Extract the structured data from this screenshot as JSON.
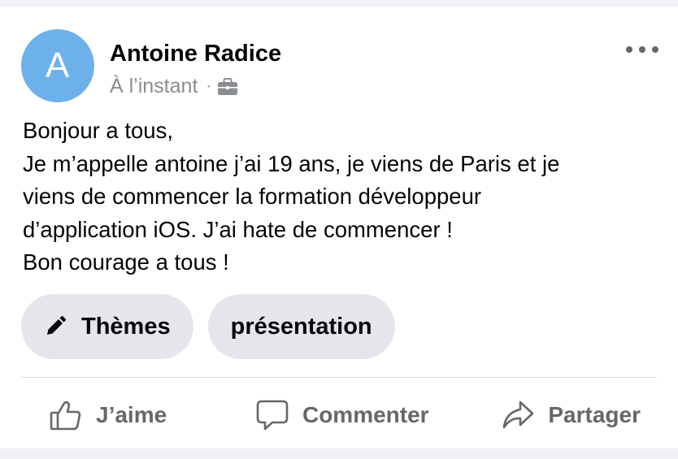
{
  "post": {
    "author": {
      "initial": "A",
      "name": "Antoine Radice",
      "avatar_color": "#6db1ea"
    },
    "meta": {
      "time": "À l’instant",
      "separator": "·",
      "visibility_icon": "briefcase-icon"
    },
    "more_icon": "more-options-icon",
    "body_lines": [
      "Bonjour a tous,",
      "Je m’appelle antoine j’ai 19 ans, je viens de Paris et je",
      "viens de commencer la formation développeur",
      "d’application iOS. J’ai hate de commencer !",
      "Bon courage a tous !"
    ],
    "tags": [
      {
        "label": "Thèmes",
        "icon": "pencil-icon"
      },
      {
        "label": "présentation"
      }
    ],
    "actions": [
      {
        "label": "J’aime",
        "icon": "thumbs-up-icon"
      },
      {
        "label": "Commenter",
        "icon": "comment-icon"
      },
      {
        "label": "Partager",
        "icon": "share-icon"
      }
    ]
  },
  "colors": {
    "background": "#f0f2f5",
    "card": "#ffffff",
    "text_primary": "#050505",
    "text_secondary": "#65676b",
    "meta_text": "#8a8d91",
    "chip_background": "#e4e6eb",
    "divider": "#dadde1"
  }
}
